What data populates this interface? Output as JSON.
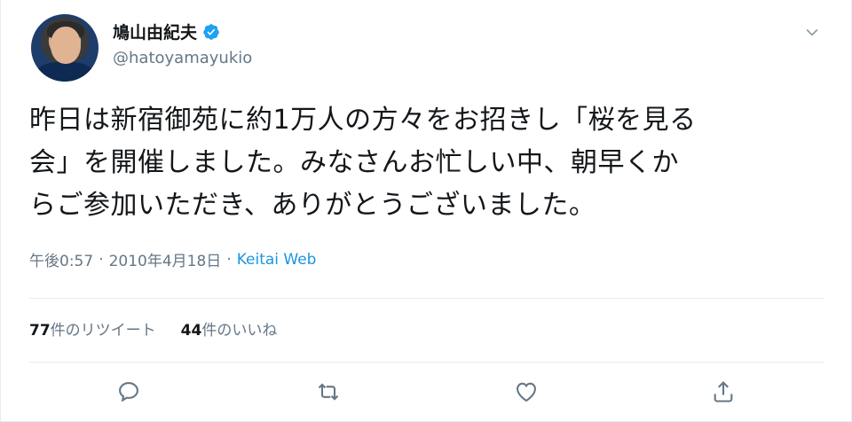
{
  "user": {
    "display_name": "鳩山由紀夫",
    "handle": "@hatoyamayukio",
    "verified": true
  },
  "tweet": {
    "lines": [
      "昨日は新宿御苑に約1万人の方々をお招きし「桜を見る",
      "会」を開催しました。みなさんお忙しい中、朝早くか",
      "らご参加いただき、ありがとうございました。"
    ],
    "time": "午後0:57",
    "separator": "·",
    "date": "2010年4月18日",
    "source": "Keitai Web"
  },
  "stats": {
    "retweets_count": "77",
    "retweets_label": "件のリツイート",
    "likes_count": "44",
    "likes_label": "件のいいね"
  },
  "colors": {
    "accent": "#1b95e0",
    "secondary_text": "#657786",
    "primary_text": "#14171a",
    "divider": "#e6ecf0"
  },
  "icons": [
    "verified-badge-icon",
    "chevron-down-icon",
    "reply-icon",
    "retweet-icon",
    "like-icon",
    "share-icon"
  ]
}
